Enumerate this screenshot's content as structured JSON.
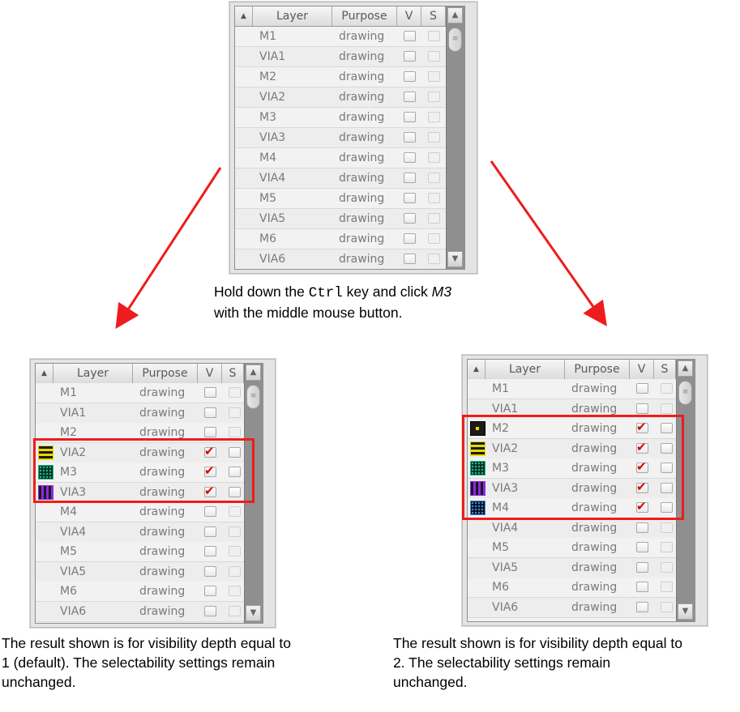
{
  "columns": {
    "layer": "Layer",
    "purpose": "Purpose",
    "v": "V",
    "s": "S"
  },
  "panels": {
    "top": {
      "rows": [
        {
          "layer": "M1",
          "purpose": "drawing",
          "v": false,
          "s": false,
          "swatch": ""
        },
        {
          "layer": "VIA1",
          "purpose": "drawing",
          "v": false,
          "s": false,
          "swatch": ""
        },
        {
          "layer": "M2",
          "purpose": "drawing",
          "v": false,
          "s": false,
          "swatch": ""
        },
        {
          "layer": "VIA2",
          "purpose": "drawing",
          "v": false,
          "s": false,
          "swatch": ""
        },
        {
          "layer": "M3",
          "purpose": "drawing",
          "v": false,
          "s": false,
          "swatch": ""
        },
        {
          "layer": "VIA3",
          "purpose": "drawing",
          "v": false,
          "s": false,
          "swatch": ""
        },
        {
          "layer": "M4",
          "purpose": "drawing",
          "v": false,
          "s": false,
          "swatch": ""
        },
        {
          "layer": "VIA4",
          "purpose": "drawing",
          "v": false,
          "s": false,
          "swatch": ""
        },
        {
          "layer": "M5",
          "purpose": "drawing",
          "v": false,
          "s": false,
          "swatch": ""
        },
        {
          "layer": "VIA5",
          "purpose": "drawing",
          "v": false,
          "s": false,
          "swatch": ""
        },
        {
          "layer": "M6",
          "purpose": "drawing",
          "v": false,
          "s": false,
          "swatch": ""
        },
        {
          "layer": "VIA6",
          "purpose": "drawing",
          "v": false,
          "s": false,
          "swatch": ""
        }
      ]
    },
    "left": {
      "rows": [
        {
          "layer": "M1",
          "purpose": "drawing",
          "v": false,
          "s": false,
          "swatch": ""
        },
        {
          "layer": "VIA1",
          "purpose": "drawing",
          "v": false,
          "s": false,
          "swatch": ""
        },
        {
          "layer": "M2",
          "purpose": "drawing",
          "v": false,
          "s": false,
          "swatch": ""
        },
        {
          "layer": "VIA2",
          "purpose": "drawing",
          "v": true,
          "s": false,
          "swatch": "via2"
        },
        {
          "layer": "M3",
          "purpose": "drawing",
          "v": true,
          "s": false,
          "swatch": "m3"
        },
        {
          "layer": "VIA3",
          "purpose": "drawing",
          "v": true,
          "s": false,
          "swatch": "via3"
        },
        {
          "layer": "M4",
          "purpose": "drawing",
          "v": false,
          "s": false,
          "swatch": ""
        },
        {
          "layer": "VIA4",
          "purpose": "drawing",
          "v": false,
          "s": false,
          "swatch": ""
        },
        {
          "layer": "M5",
          "purpose": "drawing",
          "v": false,
          "s": false,
          "swatch": ""
        },
        {
          "layer": "VIA5",
          "purpose": "drawing",
          "v": false,
          "s": false,
          "swatch": ""
        },
        {
          "layer": "M6",
          "purpose": "drawing",
          "v": false,
          "s": false,
          "swatch": ""
        },
        {
          "layer": "VIA6",
          "purpose": "drawing",
          "v": false,
          "s": false,
          "swatch": ""
        }
      ]
    },
    "right": {
      "rows": [
        {
          "layer": "M1",
          "purpose": "drawing",
          "v": false,
          "s": false,
          "swatch": ""
        },
        {
          "layer": "VIA1",
          "purpose": "drawing",
          "v": false,
          "s": false,
          "swatch": ""
        },
        {
          "layer": "M2",
          "purpose": "drawing",
          "v": true,
          "s": false,
          "swatch": "m2"
        },
        {
          "layer": "VIA2",
          "purpose": "drawing",
          "v": true,
          "s": false,
          "swatch": "via2"
        },
        {
          "layer": "M3",
          "purpose": "drawing",
          "v": true,
          "s": false,
          "swatch": "m3"
        },
        {
          "layer": "VIA3",
          "purpose": "drawing",
          "v": true,
          "s": false,
          "swatch": "via3"
        },
        {
          "layer": "M4",
          "purpose": "drawing",
          "v": true,
          "s": false,
          "swatch": "m4"
        },
        {
          "layer": "VIA4",
          "purpose": "drawing",
          "v": false,
          "s": false,
          "swatch": ""
        },
        {
          "layer": "M5",
          "purpose": "drawing",
          "v": false,
          "s": false,
          "swatch": ""
        },
        {
          "layer": "VIA5",
          "purpose": "drawing",
          "v": false,
          "s": false,
          "swatch": ""
        },
        {
          "layer": "M6",
          "purpose": "drawing",
          "v": false,
          "s": false,
          "swatch": ""
        },
        {
          "layer": "VIA6",
          "purpose": "drawing",
          "v": false,
          "s": false,
          "swatch": ""
        }
      ]
    }
  },
  "instruction": {
    "part1": "Hold down the ",
    "key": "Ctrl",
    "part2": " key and click ",
    "layer": "M3",
    "line2": "with the middle mouse button."
  },
  "captions": {
    "left": [
      "The result shown is for visibility depth equal to",
      "1 (default). The selectability settings remain",
      "unchanged."
    ],
    "right": [
      "The result shown is for visibility depth equal to",
      "2. The selectability settings remain",
      "unchanged."
    ]
  },
  "colors": {
    "arrow": "#ee1c1c",
    "highlight": "#ee1c1c",
    "check": "#d60000"
  },
  "icons": {
    "sort": "▲",
    "scroll_up": "▲",
    "scroll_down": "▼",
    "thumb_grip": "≡",
    "check": "✔"
  }
}
